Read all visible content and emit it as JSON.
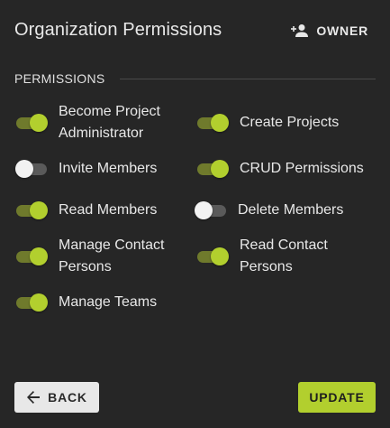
{
  "dialog": {
    "title": "Organization Permissions",
    "role_label": "OWNER",
    "role_icon": "person-add-icon"
  },
  "section": {
    "label": "PERMISSIONS"
  },
  "permissions": [
    {
      "label_line1": "Become Project",
      "label_line2": "Administrator",
      "enabled": true
    },
    {
      "label_line1": "Create Projects",
      "label_line2": "",
      "enabled": true
    },
    {
      "label_line1": "Invite Members",
      "label_line2": "",
      "enabled": false
    },
    {
      "label_line1": "CRUD Permissions",
      "label_line2": "",
      "enabled": true
    },
    {
      "label_line1": "Read Members",
      "label_line2": "",
      "enabled": true
    },
    {
      "label_line1": "Delete Members",
      "label_line2": "",
      "enabled": false
    },
    {
      "label_line1": "Manage Contact",
      "label_line2": "Persons",
      "enabled": true
    },
    {
      "label_line1": "Read Contact",
      "label_line2": "Persons",
      "enabled": true
    },
    {
      "label_line1": "Manage Teams",
      "label_line2": "",
      "enabled": true
    }
  ],
  "actions": {
    "back_label": "BACK",
    "back_icon": "arrow-left-icon",
    "update_label": "UPDATE"
  },
  "colors": {
    "accent": "#b2cf2e",
    "accent_track": "#6f7a2c",
    "background": "#262626"
  }
}
